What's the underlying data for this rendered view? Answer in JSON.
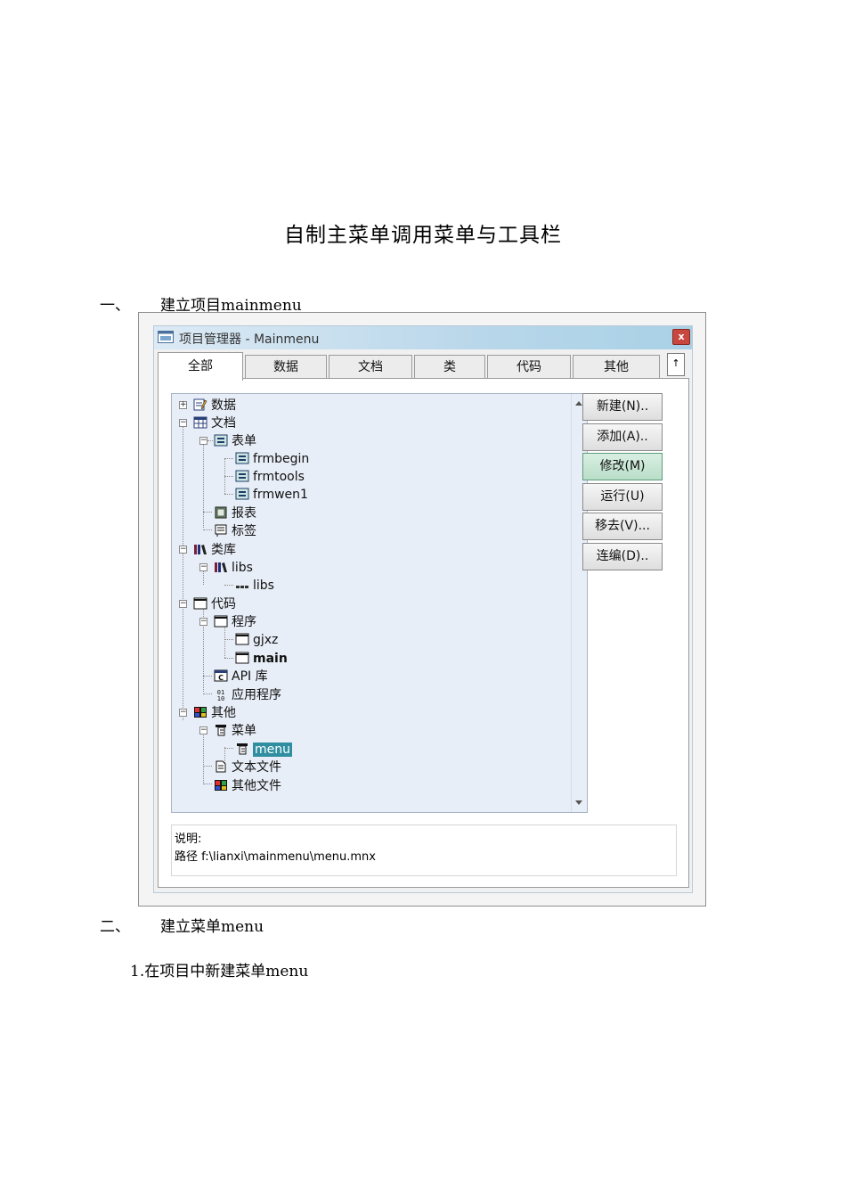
{
  "document": {
    "title": "自制主菜单调用菜单与工具栏",
    "section1_num": "一、",
    "section1_text": "建立项目mainmenu",
    "section2_num": "二、",
    "section2_text": "建立菜单menu",
    "step1": "1.在项目中新建菜单menu"
  },
  "window": {
    "title": "项目管理器 - Mainmenu",
    "close": "x",
    "tabs": [
      "全部",
      "数据",
      "文档",
      "类",
      "代码",
      "其他"
    ],
    "tab_scroll": "↑",
    "active_tab": "全部"
  },
  "tree": {
    "data": "数据",
    "docs": "文档",
    "forms": "表单",
    "form1": "frmbegin",
    "form2": "frmtools",
    "form3": "frmwen1",
    "reports": "报表",
    "labels": "标签",
    "classlibs": "类库",
    "lib": "libs",
    "libclass": "libs",
    "code": "代码",
    "programs": "程序",
    "prog1": "gjxz",
    "prog2": "main",
    "api": "API 库",
    "apps": "应用程序",
    "other": "其他",
    "menus": "菜单",
    "menu1": "menu",
    "textfiles": "文本文件",
    "otherfiles": "其他文件"
  },
  "buttons": {
    "new": "新建(N)..",
    "add": "添加(A)..",
    "modify": "修改(M)",
    "run": "运行(U)",
    "remove": "移去(V)...",
    "build": "连编(D).."
  },
  "description": {
    "label": "说明:",
    "path": "路径 f:\\lianxi\\mainmenu\\menu.mnx"
  },
  "colors": {
    "selection": "#2f8ea0",
    "tree_bg": "#e8eef7",
    "titlebar": "#a9d1e6"
  }
}
